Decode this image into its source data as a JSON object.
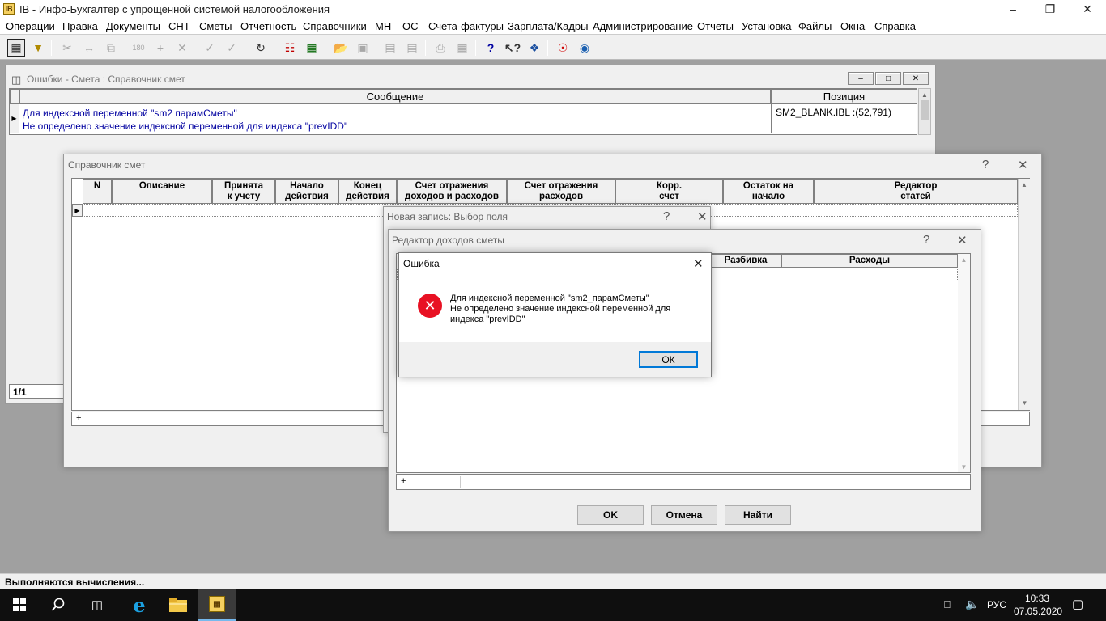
{
  "app": {
    "title": "IB - Инфо-Бухгалтер с упрощенной системой налогообложения",
    "icon_letter": "✉"
  },
  "menu": [
    "Операции",
    "Правка",
    "Документы",
    "СНТ",
    "Сметы",
    "Отчетность",
    "Справочники",
    "МН",
    "ОС",
    "Счета-фактуры",
    "Зарплата/Кадры",
    "Администрирование",
    "Отчеты",
    "Установка",
    "Файлы",
    "Окна",
    "Справка"
  ],
  "errors_window": {
    "title": "Ошибки - Смета : Справочник смет",
    "col_message": "Сообщение",
    "col_position": "Позиция",
    "row_message_line1": "Для индексной переменной \"sm2  парамСметы\"",
    "row_message_line2": "Не определено значение индексной переменной для индекса \"prevIDD\"",
    "row_position": "SM2_BLANK.IBL :(52,791)",
    "counter": "1/1"
  },
  "estimates_window": {
    "title": "Справочник смет",
    "help": "?",
    "close": "✕",
    "columns": [
      {
        "label": "N"
      },
      {
        "label": "Описание"
      },
      {
        "label": "Принята\nк учету"
      },
      {
        "label": "Начало\nдействия"
      },
      {
        "label": "Конец\nдействия"
      },
      {
        "label": "Счет отражения\nдоходов и расходов"
      },
      {
        "label": "Счет отражения\nрасходов"
      },
      {
        "label": "Корр.\nсчет"
      },
      {
        "label": "Остаток на\nначало"
      },
      {
        "label": "Редактор\nстатей"
      }
    ],
    "plus": "+"
  },
  "field_dialog": {
    "title": "Новая запись: Выбор поля",
    "help": "?",
    "close": "✕"
  },
  "income_editor": {
    "title": "Редактор доходов сметы",
    "help": "?",
    "close": "✕",
    "col_split": "Разбивка",
    "col_expenses": "Расходы",
    "plus": "+",
    "ok": "OK",
    "cancel": "Отмена",
    "find": "Найти"
  },
  "error_dialog": {
    "title": "Ошибка",
    "close": "✕",
    "line1": "Для индексной переменной \"sm2_парамСметы\"",
    "line2": "Не определено значение индексной переменной для",
    "line3": "индекса \"prevIDD\"",
    "ok": "ОК",
    "icon_color": "#e81123"
  },
  "status": {
    "text": "Выполняются вычисления..."
  },
  "taskbar": {
    "lang": "РУС",
    "time": "10:33",
    "date": "07.05.2020"
  }
}
